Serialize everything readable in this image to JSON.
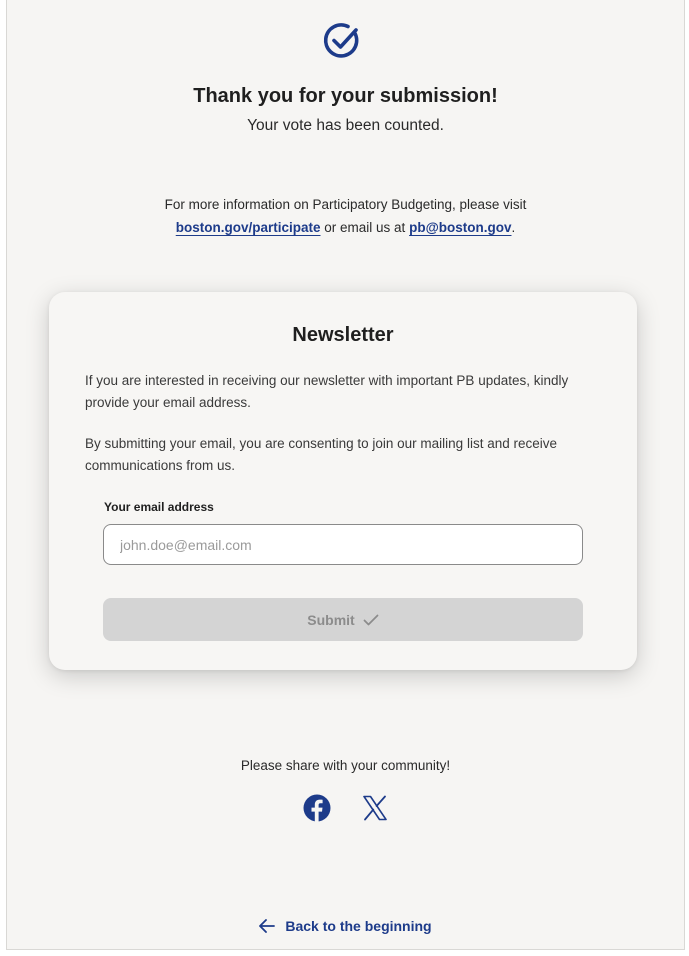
{
  "header": {
    "icon": "check-circle-icon",
    "title": "Thank you for your submission!",
    "subtitle": "Your vote has been counted."
  },
  "info": {
    "text_before": "For more information on Participatory Budgeting, please visit",
    "link1": "boston.gov/participate",
    "text_middle": "or email us at",
    "link2": "pb@boston.gov",
    "text_after": "."
  },
  "newsletter": {
    "title": "Newsletter",
    "paragraph1": "If you are interested in receiving our newsletter with important PB updates, kindly provide your email address.",
    "paragraph2": "By submitting your email, you are consenting to join our mailing list and receive communications from us.",
    "email_label": "Your email address",
    "email_placeholder": "john.doe@email.com",
    "email_value": "",
    "submit_label": "Submit",
    "submit_icon": "checkmark-icon"
  },
  "share": {
    "text": "Please share with your community!",
    "icons": [
      "facebook-icon",
      "x-icon"
    ]
  },
  "footer": {
    "back_label": "Back to the beginning",
    "back_icon": "arrow-left-icon"
  },
  "colors": {
    "accent": "#1d3b8a",
    "page_background": "#f6f5f3",
    "button_disabled": "#d4d4d4"
  }
}
